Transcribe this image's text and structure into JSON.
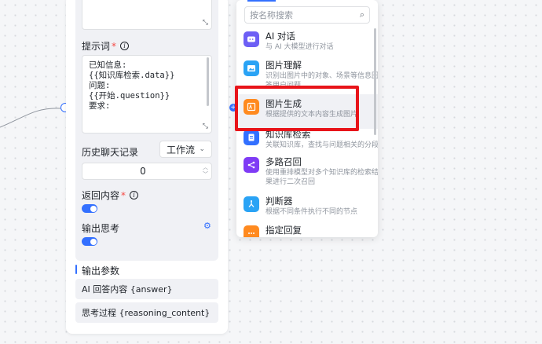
{
  "node": {
    "prompt_label": "提示词",
    "prompt_required": "*",
    "prompt_text": "已知信息:\n{{知识库检索.data}}\n问题:\n{{开始.question}}\n要求:",
    "history_label": "历史聊天记录",
    "history_select": "工作流",
    "history_value": "0",
    "return_label": "返回内容",
    "return_required": "*",
    "return_toggle": "on",
    "thinking_label": "输出思考",
    "thinking_toggle": "on",
    "output_params_label": "输出参数",
    "outputs": [
      "AI 回答内容 {answer}",
      "思考过程 {reasoning_content}"
    ]
  },
  "dropdown": {
    "search_placeholder": "按名称搜索",
    "items": [
      {
        "title": "AI 对话",
        "desc": "与 AI 大模型进行对话",
        "icon": "chat-bot-icon",
        "color": "#6d5ff5"
      },
      {
        "title": "图片理解",
        "desc": "识别出图片中的对象、场景等信息回答用户问题",
        "icon": "image-icon",
        "color": "#2aa3f5"
      },
      {
        "title": "图片生成",
        "desc": "根据提供的文本内容生成图片",
        "icon": "image-generate-icon",
        "color": "#ff8a1f"
      },
      {
        "title": "知识库检索",
        "desc": "关联知识库，查找与问题相关的分段",
        "icon": "knowledge-icon",
        "color": "#3370ff"
      },
      {
        "title": "多路召回",
        "desc": "使用重排模型对多个知识库的检索结果进行二次召回",
        "icon": "multi-recall-icon",
        "color": "#7f3bf5"
      },
      {
        "title": "判断器",
        "desc": "根据不同条件执行不同的节点",
        "icon": "branch-icon",
        "color": "#2aa3f5"
      },
      {
        "title": "指定回复",
        "desc": "",
        "icon": "reply-icon",
        "color": "#ff8a1f"
      }
    ]
  }
}
